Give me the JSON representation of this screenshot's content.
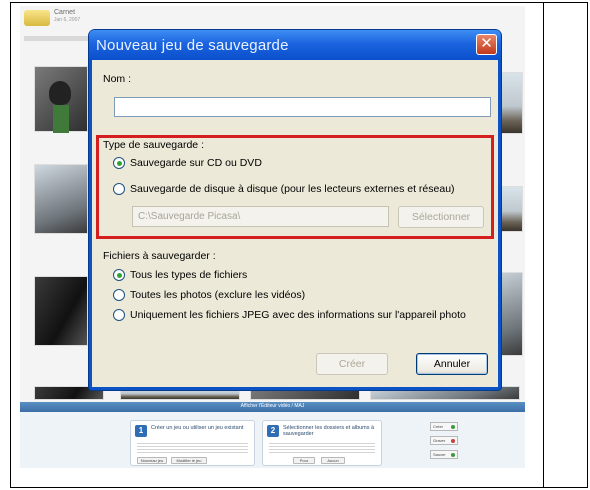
{
  "background_app": {
    "title": "Carnet",
    "subtitle": "Jan 6, 2007",
    "wizard_bar": "Afficher l'Éditeur vidéo / MAJ",
    "step1": {
      "number": "1",
      "title": "Créer un jeu ou utiliser un jeu existant"
    },
    "step2": {
      "number": "2",
      "title": "Sélectionner les dossiers et albums à sauvegarder"
    },
    "buttons": [
      "Créer",
      "Graver",
      "Sauver",
      "Pour",
      "Aucun",
      "Nouveau jeu",
      "Modifier le jeu"
    ]
  },
  "dialog": {
    "title": "Nouveau jeu de sauvegarde",
    "name_label": "Nom :",
    "name_value": "",
    "backup_type": {
      "label": "Type de sauvegarde :",
      "options": [
        {
          "label": "Sauvegarde sur CD ou DVD",
          "selected": true
        },
        {
          "label": "Sauvegarde de disque à disque (pour les lecteurs externes et réseau)",
          "selected": false
        }
      ],
      "path_value": "C:\\Sauvegarde Picasa\\",
      "select_button": "Sélectionner"
    },
    "files": {
      "label": "Fichiers à sauvegarder :",
      "options": [
        {
          "label": "Tous les types de fichiers",
          "selected": true
        },
        {
          "label": "Toutes les photos (exclure les vidéos)",
          "selected": false
        },
        {
          "label": "Uniquement les fichiers JPEG avec des informations sur l'appareil photo",
          "selected": false
        }
      ]
    },
    "create_button": "Créer",
    "cancel_button": "Annuler"
  },
  "colors": {
    "titlebar": "#1c64df",
    "highlight_border": "#d51f1f",
    "dialog_body": "#ece9d8",
    "radio_selected": "#2fa52f"
  },
  "icons": {
    "close": "close-icon",
    "radio_on": "radio-selected-icon",
    "radio_off": "radio-unselected-icon"
  }
}
